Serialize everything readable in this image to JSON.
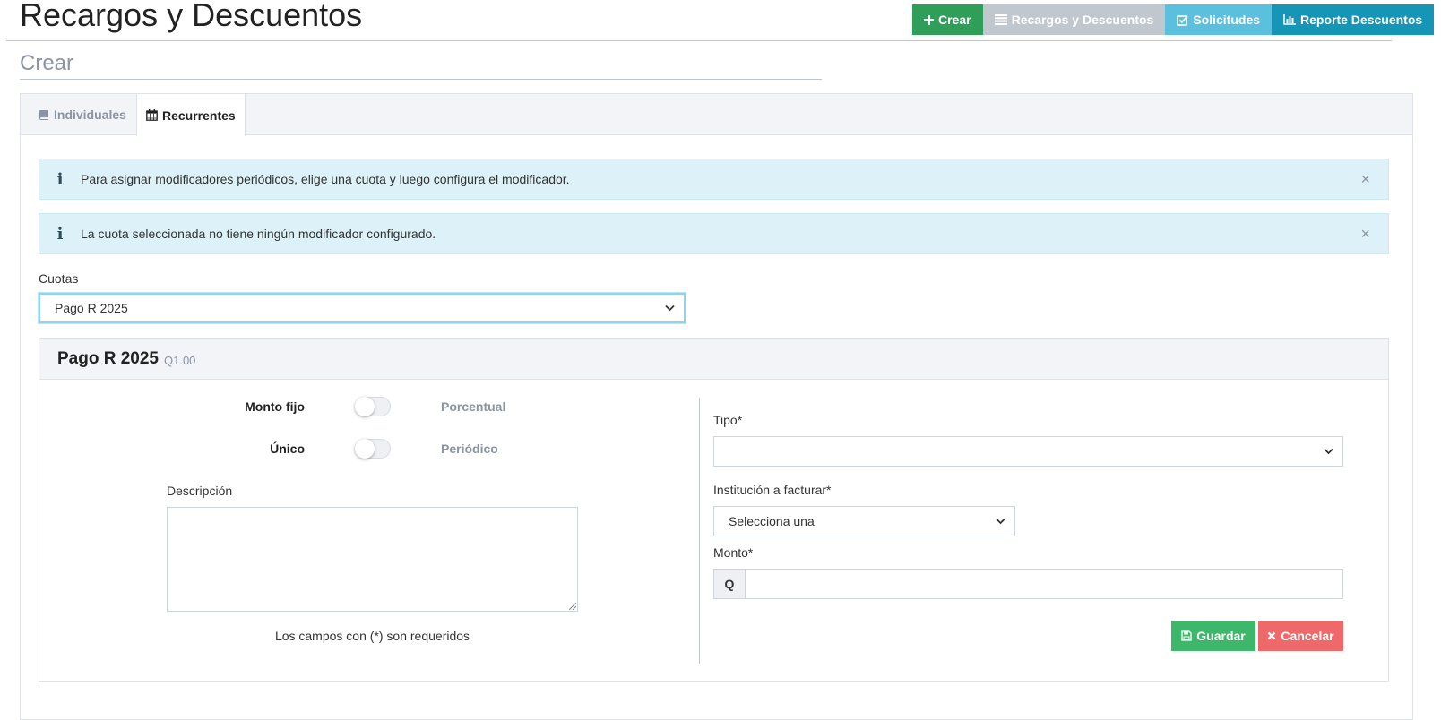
{
  "header": {
    "title": "Recargos y Descuentos",
    "actions": [
      {
        "label": "Crear",
        "icon": "plus-icon",
        "color": "#2e9e58"
      },
      {
        "label": "Recargos y Descuentos",
        "icon": "list-icon",
        "color": "#c1c7ce"
      },
      {
        "label": "Solicitudes",
        "icon": "check-square-icon",
        "color": "#5bc0de"
      },
      {
        "label": "Reporte Descuentos",
        "icon": "bar-chart-icon",
        "color": "#1596b6"
      }
    ]
  },
  "section": {
    "subtitle": "Crear"
  },
  "tabs": [
    {
      "label": "Individuales",
      "icon": "book-icon",
      "active": false
    },
    {
      "label": "Recurrentes",
      "icon": "calendar-icon",
      "active": true
    }
  ],
  "alerts": [
    {
      "text": "Para asignar modificadores periódicos, elige una cuota y luego configura el modificador.",
      "close": "×"
    },
    {
      "text": "La cuota seleccionada no tiene ningún modificador configurado.",
      "close": "×"
    }
  ],
  "cuotas": {
    "label": "Cuotas",
    "selected": "Pago R 2025"
  },
  "card": {
    "title": "Pago R 2025",
    "amount": "Q1.00",
    "toggles": [
      {
        "left": "Monto fijo",
        "right": "Porcentual",
        "on": false
      },
      {
        "left": "Único",
        "right": "Periódico",
        "on": false
      }
    ],
    "descripcion": {
      "label": "Descripción",
      "value": ""
    },
    "required_note": "Los campos con (*) son requeridos",
    "tipo": {
      "label": "Tipo*",
      "selected": ""
    },
    "institucion": {
      "label": "Institución a facturar*",
      "selected": "Selecciona una"
    },
    "monto": {
      "label": "Monto*",
      "prefix": "Q",
      "value": ""
    },
    "save_label": "Guardar",
    "cancel_label": "Cancelar"
  },
  "colors": {
    "accent_teal": "#1596b6",
    "save_green": "#3db86b",
    "cancel_red": "#f0696a",
    "info_bg": "#ddf2f8"
  }
}
